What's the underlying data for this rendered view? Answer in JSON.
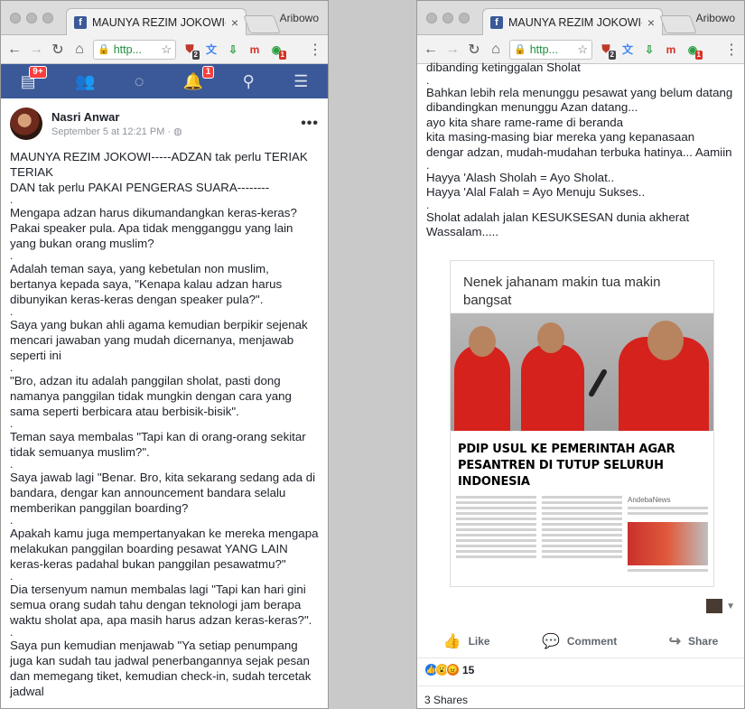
{
  "browser": {
    "tab_title": "MAUNYA REZIM JOKOWI----",
    "tab_close": "×",
    "profile_name": "Aribowo",
    "url_text": "http...",
    "favicon": "f",
    "ext_labels": [
      "2",
      "1"
    ]
  },
  "fb_nav": {
    "home_badge": "9+",
    "notifications_badge": "1"
  },
  "post": {
    "author": "Nasri Anwar",
    "meta": "September 5 at 12:21 PM · ",
    "paragraphs_left": [
      "MAUNYA REZIM JOKOWI-----ADZAN tak perlu TERIAK TERIAK",
      "DAN tak perlu PAKAI PENGERAS SUARA--------",
      ".",
      "Mengapa adzan harus dikumandangkan keras-keras? Pakai speaker pula. Apa tidak mengganggu yang lain yang bukan orang muslim?",
      ".",
      "Adalah teman saya, yang kebetulan non muslim, bertanya kepada saya, \"Kenapa kalau adzan harus dibunyikan keras-keras dengan speaker pula?\".",
      ".",
      "Saya yang bukan ahli agama kemudian berpikir sejenak mencari jawaban yang mudah dicernanya, menjawab seperti ini",
      ".",
      "\"Bro, adzan itu adalah panggilan sholat, pasti dong namanya panggilan tidak mungkin dengan cara yang sama seperti berbicara atau berbisik-bisik\".",
      ".",
      "Teman saya membalas \"Tapi kan di orang-orang sekitar tidak semuanya muslim?\".",
      ".",
      "Saya jawab lagi \"Benar. Bro, kita sekarang sedang ada di bandara, dengar kan announcement bandara selalu memberikan panggilan boarding?",
      ".",
      "Apakah kamu juga mempertanyakan ke mereka mengapa melakukan panggilan boarding pesawat YANG LAIN keras-keras padahal bukan panggilan pesawatmu?\"",
      ".",
      "Dia tersenyum namun membalas lagi \"Tapi kan hari gini semua orang sudah tahu dengan teknologi jam berapa waktu sholat apa, apa masih harus adzan keras-keras?\".",
      ".",
      "Saya pun kemudian menjawab \"Ya setiap penumpang juga kan sudah tau jadwal penerbangannya sejak pesan dan memegang tiket, kemudian check-in, sudah tercetak jadwal"
    ],
    "paragraphs_right": [
      "dibanding ketinggalan Sholat",
      ".",
      "Bahkan lebih rela menunggu pesawat yang belum datang dibandingkan menunggu Azan datang...",
      "ayo kita share rame-rame di beranda",
      "kita masing-masing biar mereka yang kepanasaan dengar adzan, mudah-mudahan terbuka hatinya... Aamiin",
      ".",
      "Hayya 'Alash Sholah = Ayo Sholat..",
      "Hayya 'Alal Falah = Ayo Menuju Sukses..",
      ".",
      "Sholat adalah jalan KESUKSESAN dunia akherat",
      "Wassalam....."
    ],
    "image": {
      "headline": "Nenek jahanam makin tua makin bangsat",
      "caption": "PDIP USUL KE PEMERINTAH AGAR PESANTREN DI TUTUP SELURUH INDONESIA",
      "site": "AndebaNews"
    },
    "actions": {
      "like": "Like",
      "comment": "Comment",
      "share": "Share"
    },
    "reaction_count": "15",
    "shares": "3 Shares"
  },
  "colors": {
    "facebook_blue": "#3b5998",
    "badge_red": "#fa3e3e",
    "secure_green": "#1e8e3e"
  }
}
